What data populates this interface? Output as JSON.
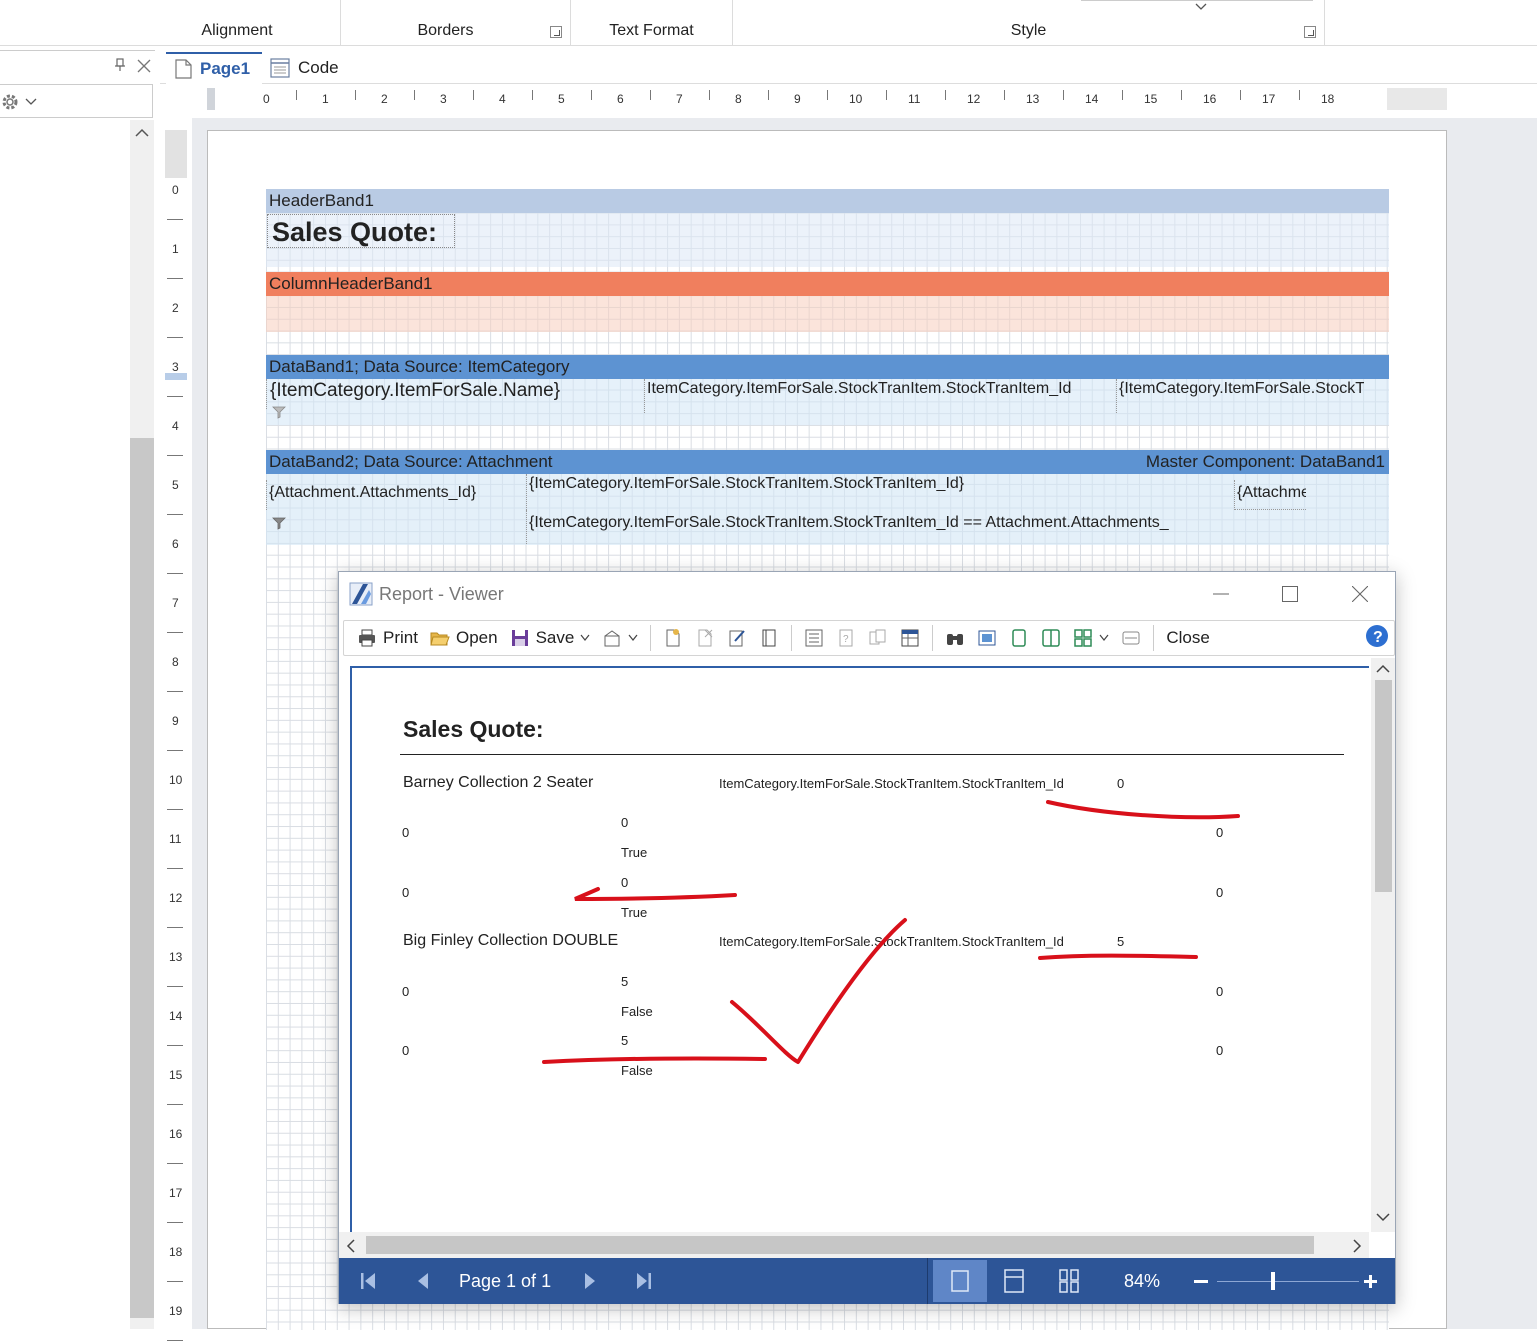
{
  "ribbon": {
    "groups": [
      "Alignment",
      "Borders",
      "Text Format",
      "Style"
    ]
  },
  "tabs": {
    "page": "Page1",
    "code": "Code"
  },
  "h_ruler": [
    "0",
    "1",
    "2",
    "3",
    "4",
    "5",
    "6",
    "7",
    "8",
    "9",
    "10",
    "11",
    "12",
    "13",
    "14",
    "15",
    "16",
    "17",
    "18"
  ],
  "v_ruler": [
    "0",
    "1",
    "2",
    "3",
    "4",
    "5",
    "6",
    "7",
    "8",
    "9",
    "10",
    "11",
    "12",
    "13",
    "14",
    "15",
    "16",
    "17",
    "18",
    "19"
  ],
  "designer": {
    "header_band": {
      "title": "HeaderBand1",
      "text": "Sales Quote:"
    },
    "column_header_band": {
      "title": "ColumnHeaderBand1"
    },
    "data_band1": {
      "title": "DataBand1; Data Source: ItemCategory",
      "field1": "{ItemCategory.ItemForSale.Name}",
      "field2": "ItemCategory.ItemForSale.StockTranItem.StockTranItem_Id",
      "field3": "{ItemCategory.ItemForSale.StockTi"
    },
    "data_band2": {
      "title": "DataBand2; Data Source: Attachment",
      "master": "Master Component: DataBand1",
      "field1": "{Attachment.Attachments_Id}",
      "field2": "{ItemCategory.ItemForSale.StockTranItem.StockTranItem_Id}",
      "field3": "{ItemCategory.ItemForSale.StockTranItem.StockTranItem_Id  ==  Attachment.Attachments_",
      "field4": "{Attachme"
    }
  },
  "viewer": {
    "title": "Report - Viewer",
    "toolbar": {
      "print": "Print",
      "open": "Open",
      "save": "Save",
      "close": "Close"
    },
    "report": {
      "title": "Sales Quote:",
      "groups": [
        {
          "name": "Barney Collection 2 Seater",
          "id_label": "ItemCategory.ItemForSale.StockTranItem.StockTranItem_Id",
          "id_value": "0",
          "rows": [
            {
              "left": "0",
              "mid": "0",
              "flag": "True",
              "right": "0"
            },
            {
              "left": "0",
              "mid": "0",
              "flag": "True",
              "right": "0"
            }
          ]
        },
        {
          "name": "Big Finley Collection DOUBLE",
          "id_label": "ItemCategory.ItemForSale.StockTranItem.StockTranItem_Id",
          "id_value": "5",
          "rows": [
            {
              "left": "0",
              "mid": "5",
              "flag": "False",
              "right": "0"
            },
            {
              "left": "0",
              "mid": "5",
              "flag": "False",
              "right": "0"
            }
          ]
        }
      ]
    },
    "status": {
      "page": "Page 1 of 1",
      "zoom": "84%"
    }
  },
  "colors": {
    "header_band": "#b9cbe4",
    "column_header_band": "#f07f5e",
    "data_band": "#5d93d2",
    "status_bar": "#2d5597",
    "annotation": "#d8101a"
  }
}
